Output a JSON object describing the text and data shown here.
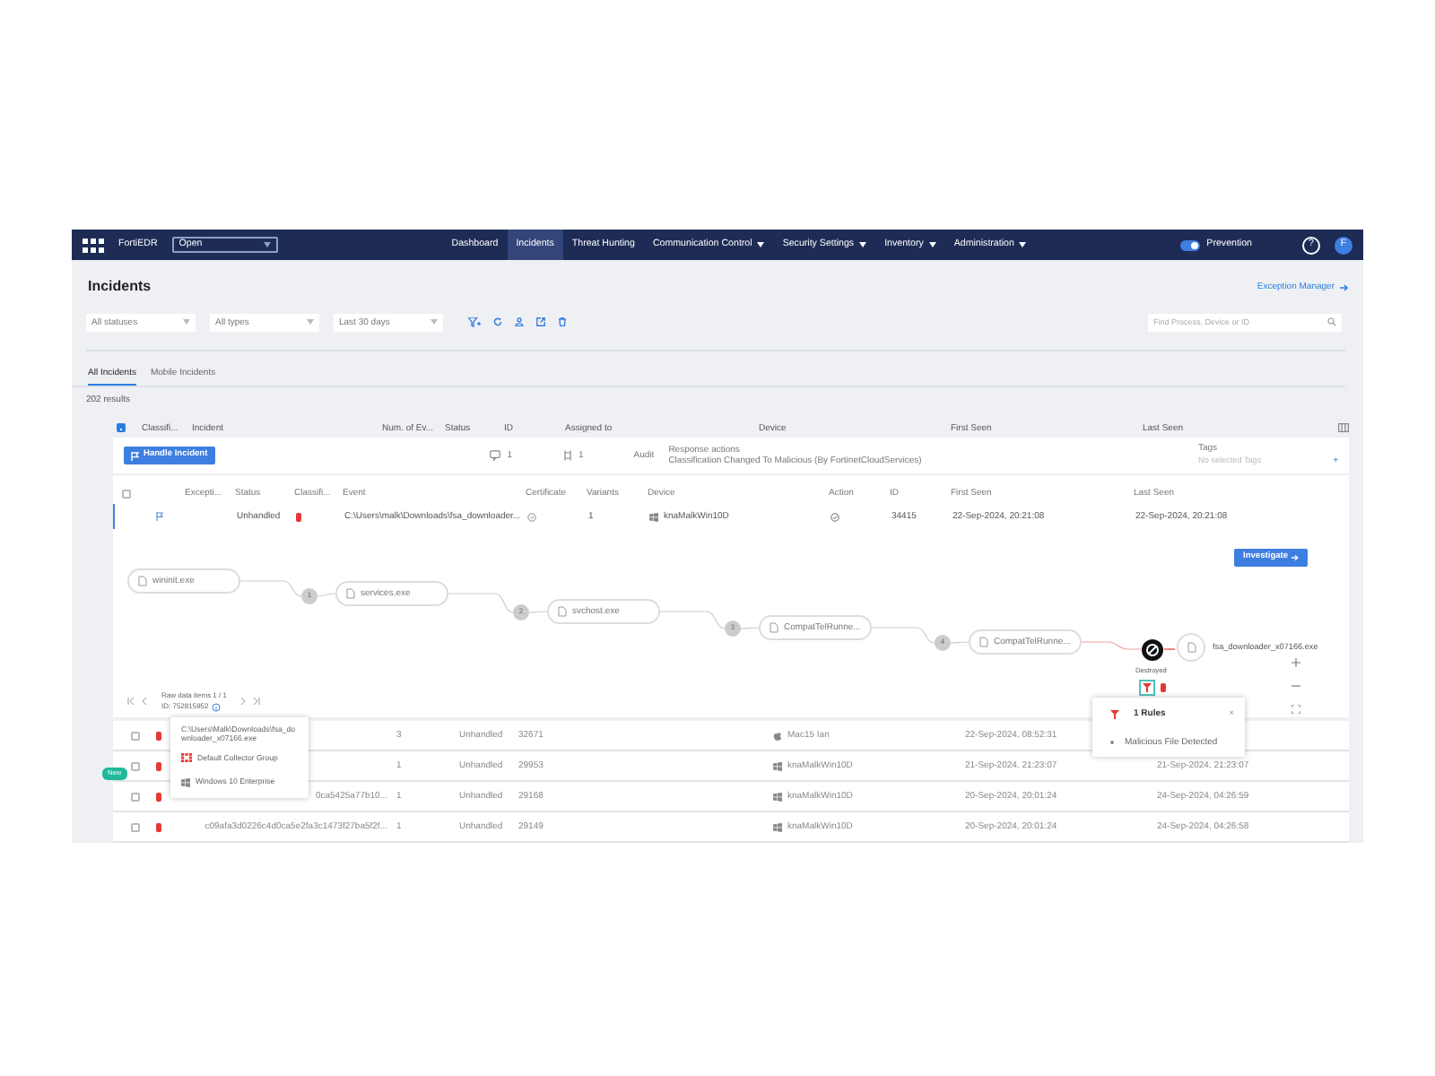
{
  "navbar": {
    "logo": "FortiEDR",
    "org_select": "Open",
    "items": [
      {
        "label": "Dashboard",
        "selected": false,
        "dropdown": false
      },
      {
        "label": "Incidents",
        "selected": true,
        "dropdown": false
      },
      {
        "label": "Threat Hunting",
        "selected": false,
        "dropdown": false
      },
      {
        "label": "Communication Control",
        "selected": false,
        "dropdown": true
      },
      {
        "label": "Security Settings",
        "selected": false,
        "dropdown": true
      },
      {
        "label": "Inventory",
        "selected": false,
        "dropdown": true
      },
      {
        "label": "Administration",
        "selected": false,
        "dropdown": true
      }
    ],
    "prevention": {
      "label": "Prevention",
      "on": true
    },
    "help": "?",
    "avatar": "F"
  },
  "page": {
    "title": "Incidents",
    "exception_link": "Exception Manager"
  },
  "filters": {
    "selects": [
      "All statuses",
      "All types",
      "Last 30 days"
    ],
    "search": {
      "placeholder": "Find Process, Device or ID"
    }
  },
  "tabs": [
    {
      "label": "All Incidents",
      "selected": true
    },
    {
      "label": "Mobile Incidents",
      "selected": false
    }
  ],
  "results": "202 results",
  "table": {
    "select_all_indeterminate": true,
    "columns": [
      "Classifi...",
      "Incident",
      "Num. of Ev...",
      "Status",
      "ID",
      "Assigned to",
      "Device",
      "First Seen",
      "Last Seen"
    ],
    "expanded": {
      "handle_button": "Handle Incident",
      "comments": "1",
      "rules": "1",
      "audit": "Audit",
      "response_label": "Response actions",
      "response_text": "Classification Changed To Malicious (By FortinetCloudServices)",
      "tags_label": "Tags",
      "select_all_checked": false,
      "tags_field": {
        "placeholder": "No selected Tags"
      },
      "tags_add": "+",
      "event_columns": [
        "Excepti...",
        "Status",
        "Classifi...",
        "Event",
        "Certificate",
        "Variants",
        "Device",
        "Action",
        "ID",
        "First Seen",
        "Last Seen"
      ],
      "events": [
        {
          "selected": true,
          "status": "Unhandled",
          "event": "C:\\Users\\malk\\Downloads\\fsa_downloader...",
          "variants": "1",
          "device": "knaMalkWin10D",
          "id": "34415",
          "first_seen": "22-Sep-2024, 20:21:08",
          "last_seen": "22-Sep-2024, 20:21:08"
        }
      ],
      "investigate": "Investigate",
      "graph": {
        "nodes": [
          {
            "kind": "process",
            "label": "wininit.exe"
          },
          {
            "kind": "process",
            "label": "services.exe"
          },
          {
            "kind": "process",
            "label": "svchost.exe"
          },
          {
            "kind": "process",
            "label": "CompatTelRunne..."
          },
          {
            "kind": "process",
            "label": "CompatTelRunne..."
          },
          {
            "kind": "destroyed",
            "label": "Destroyed"
          },
          {
            "kind": "file",
            "label": "fsa_downloader_x07166.exe"
          }
        ],
        "steps": [
          "1",
          "2",
          "3",
          "4"
        ]
      },
      "raw_data": {
        "label": "Raw data items 1 / 1",
        "id": "ID: 752815952"
      }
    },
    "rows": [
      {
        "checked": false,
        "new": false,
        "incident": "",
        "events": "3",
        "status": "Unhandled",
        "id": "32671",
        "kind": "mac",
        "device": "Mac15 Ian",
        "first_seen": "22-Sep-2024, 08:52:31",
        "last_seen": ""
      },
      {
        "checked": false,
        "new": true,
        "incident": "",
        "events": "1",
        "status": "Unhandled",
        "id": "29953",
        "kind": "windows",
        "device": "knaMalkWin10D",
        "first_seen": "21-Sep-2024, 21:23:07",
        "last_seen": "21-Sep-2024, 21:23:07"
      },
      {
        "checked": false,
        "new": false,
        "incident": "0ca5425a77b10...",
        "events": "1",
        "status": "Unhandled",
        "id": "29168",
        "kind": "windows",
        "device": "knaMalkWin10D",
        "first_seen": "20-Sep-2024, 20:01:24",
        "last_seen": "24-Sep-2024, 04:26:59"
      },
      {
        "checked": false,
        "new": false,
        "incident": "c09afa3d0226c4d0ca5e2fa3c1473f27ba5f2f...",
        "events": "1",
        "status": "Unhandled",
        "id": "29149",
        "kind": "windows",
        "device": "knaMalkWin10D",
        "first_seen": "20-Sep-2024, 20:01:24",
        "last_seen": "24-Sep-2024, 04:26:58"
      }
    ]
  },
  "new_badge": "New",
  "device_popup": {
    "path": "C:\\Users\\Malk\\Downloads\\fsa_downloader_x07166.exe",
    "group": "Default Collector Group",
    "os": "Windows 10 Enterprise"
  },
  "rules_popup": {
    "title": "1 Rules",
    "close": "×",
    "rules": [
      "Malicious File Detected"
    ]
  }
}
